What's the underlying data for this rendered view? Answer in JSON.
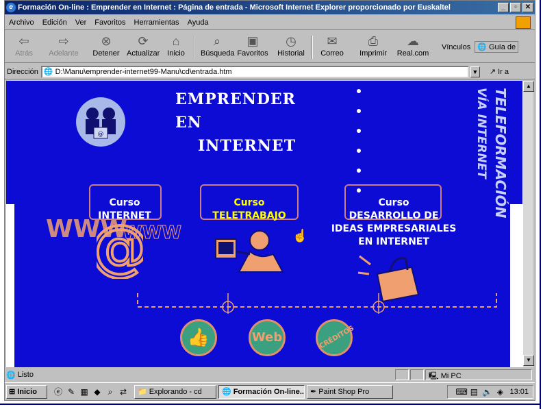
{
  "window": {
    "title": "Formación On-line : Emprender en Internet : Página de entrada - Microsoft Internet Explorer proporcionado por Euskaltel",
    "controls": [
      "_",
      "▫",
      "✕"
    ]
  },
  "menu": [
    "Archivo",
    "Edición",
    "Ver",
    "Favoritos",
    "Herramientas",
    "Ayuda"
  ],
  "toolbar": {
    "back": "Atrás",
    "forward": "Adelante",
    "stop": "Detener",
    "refresh": "Actualizar",
    "home": "Inicio",
    "search": "Búsqueda",
    "favorites": "Favoritos",
    "history": "Historial",
    "mail": "Correo",
    "print": "Imprimir",
    "realcom": "Real.com",
    "links_label": "Vínculos",
    "guia": "Guía de"
  },
  "address": {
    "label": "Dirección",
    "value": "D:\\Manu\\emprender-internet99-Manu\\cd\\entrada.htm",
    "go": "Ir a"
  },
  "page": {
    "title_line1": "EMPRENDER",
    "title_line2": "EN",
    "title_line3": "INTERNET",
    "side_title_1": "TELEFORMACIÓN",
    "side_title_2": "VÍA INTERNET",
    "courses": [
      {
        "line1": "Curso",
        "line2": "INTERNET"
      },
      {
        "line1": "Curso",
        "line2": "TELETRABAJO"
      },
      {
        "line1": "Curso",
        "line2": "DESARROLLO DE",
        "line3": "IDEAS EMPRESARIALES",
        "line4": "EN INTERNET"
      }
    ],
    "www1": "WWW",
    "www2": "WWW",
    "web_button": "Web",
    "creditos_button": "CRÉDITOS"
  },
  "status": {
    "text": "Listo",
    "zone": "Mi PC"
  },
  "taskbar": {
    "start": "Inicio",
    "tasks": [
      "Explorando - cd",
      "Formación On-line...",
      "Paint Shop Pro"
    ],
    "clock": "13:01"
  },
  "colors": {
    "page_bg": "#0c0cd4",
    "accent_orange": "#f0a070",
    "highlight_yellow": "#ffff00"
  }
}
